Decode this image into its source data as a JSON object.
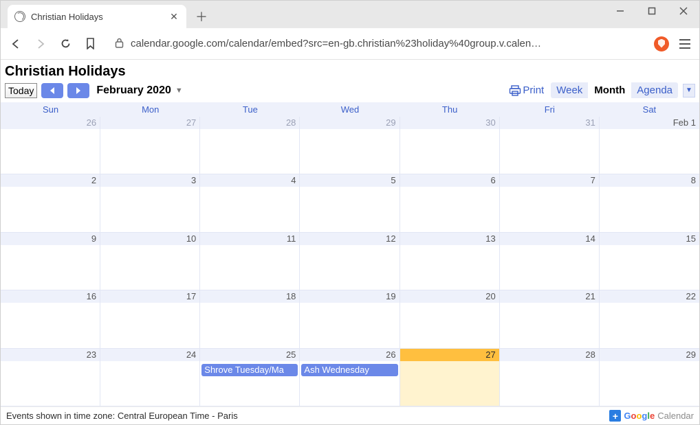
{
  "browser": {
    "tab_title": "Christian Holidays",
    "url": "calendar.google.com/calendar/embed?src=en-gb.christian%23holiday%40group.v.calen…"
  },
  "calendar": {
    "title": "Christian Holidays",
    "today_label": "Today",
    "month_label": "February 2020",
    "print_label": "Print",
    "views": {
      "week": "Week",
      "month": "Month",
      "agenda": "Agenda",
      "active": "month"
    },
    "day_headers": [
      "Sun",
      "Mon",
      "Tue",
      "Wed",
      "Thu",
      "Fri",
      "Sat"
    ],
    "weeks": [
      [
        {
          "label": "26",
          "outside": true
        },
        {
          "label": "27",
          "outside": true
        },
        {
          "label": "28",
          "outside": true
        },
        {
          "label": "29",
          "outside": true
        },
        {
          "label": "30",
          "outside": true
        },
        {
          "label": "31",
          "outside": true
        },
        {
          "label": "Feb 1"
        }
      ],
      [
        {
          "label": "2"
        },
        {
          "label": "3"
        },
        {
          "label": "4"
        },
        {
          "label": "5"
        },
        {
          "label": "6"
        },
        {
          "label": "7"
        },
        {
          "label": "8"
        }
      ],
      [
        {
          "label": "9"
        },
        {
          "label": "10"
        },
        {
          "label": "11"
        },
        {
          "label": "12"
        },
        {
          "label": "13"
        },
        {
          "label": "14"
        },
        {
          "label": "15"
        }
      ],
      [
        {
          "label": "16"
        },
        {
          "label": "17"
        },
        {
          "label": "18"
        },
        {
          "label": "19"
        },
        {
          "label": "20"
        },
        {
          "label": "21"
        },
        {
          "label": "22"
        }
      ],
      [
        {
          "label": "23"
        },
        {
          "label": "24"
        },
        {
          "label": "25",
          "event": "Shrove Tuesday/Ma"
        },
        {
          "label": "26",
          "event": "Ash Wednesday"
        },
        {
          "label": "27",
          "today": true
        },
        {
          "label": "28"
        },
        {
          "label": "29"
        }
      ]
    ],
    "timezone_note": "Events shown in time zone: Central European Time - Paris",
    "gcal_brand": "Google",
    "gcal_word": "Calendar"
  }
}
